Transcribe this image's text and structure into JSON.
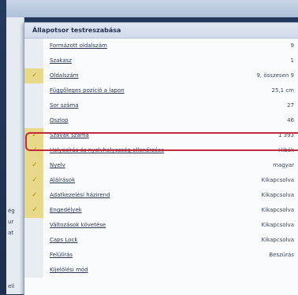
{
  "menu": {
    "header": "Állapotsor testreszabása",
    "items": [
      {
        "label": "Formázott oldalszám",
        "value": "9",
        "checked": false
      },
      {
        "label": "Szakasz",
        "value": "1",
        "checked": false
      },
      {
        "label": "Oldalszám",
        "value": "9, összesen 9",
        "checked": true
      },
      {
        "label": "Függőleges pozíció a lapon",
        "value": "25,1 cm",
        "checked": false
      },
      {
        "label": "Sor száma",
        "value": "27",
        "checked": false
      },
      {
        "label": "Oszlop",
        "value": "46",
        "checked": false
      },
      {
        "label": "Szavak száma",
        "value": "1 393",
        "checked": true
      },
      {
        "label": "Helyesírás és nyelvhelyesség ellenőrzése",
        "value": "Hibák",
        "checked": true
      },
      {
        "label": "Nyelv",
        "value": "magyar",
        "checked": true
      },
      {
        "label": "Aláírások",
        "value": "Kikapcsolva",
        "checked": true
      },
      {
        "label": "Adatkezelési házirend",
        "value": "Kikapcsolva",
        "checked": true
      },
      {
        "label": "Engedélyek",
        "value": "Kikapcsolva",
        "checked": true
      },
      {
        "label": "Változások követése",
        "value": "Kikapcsolva",
        "checked": false
      },
      {
        "label": "Caps Lock",
        "value": "Kikapcsolva",
        "checked": false
      },
      {
        "label": "Felülírás",
        "value": "Beszúrás",
        "checked": false
      },
      {
        "label": "Kijelölési mód",
        "value": "",
        "checked": false
      }
    ]
  },
  "check_glyph": "✓",
  "background_fragments": [
    "ég",
    "ur",
    "at",
    "eli"
  ]
}
